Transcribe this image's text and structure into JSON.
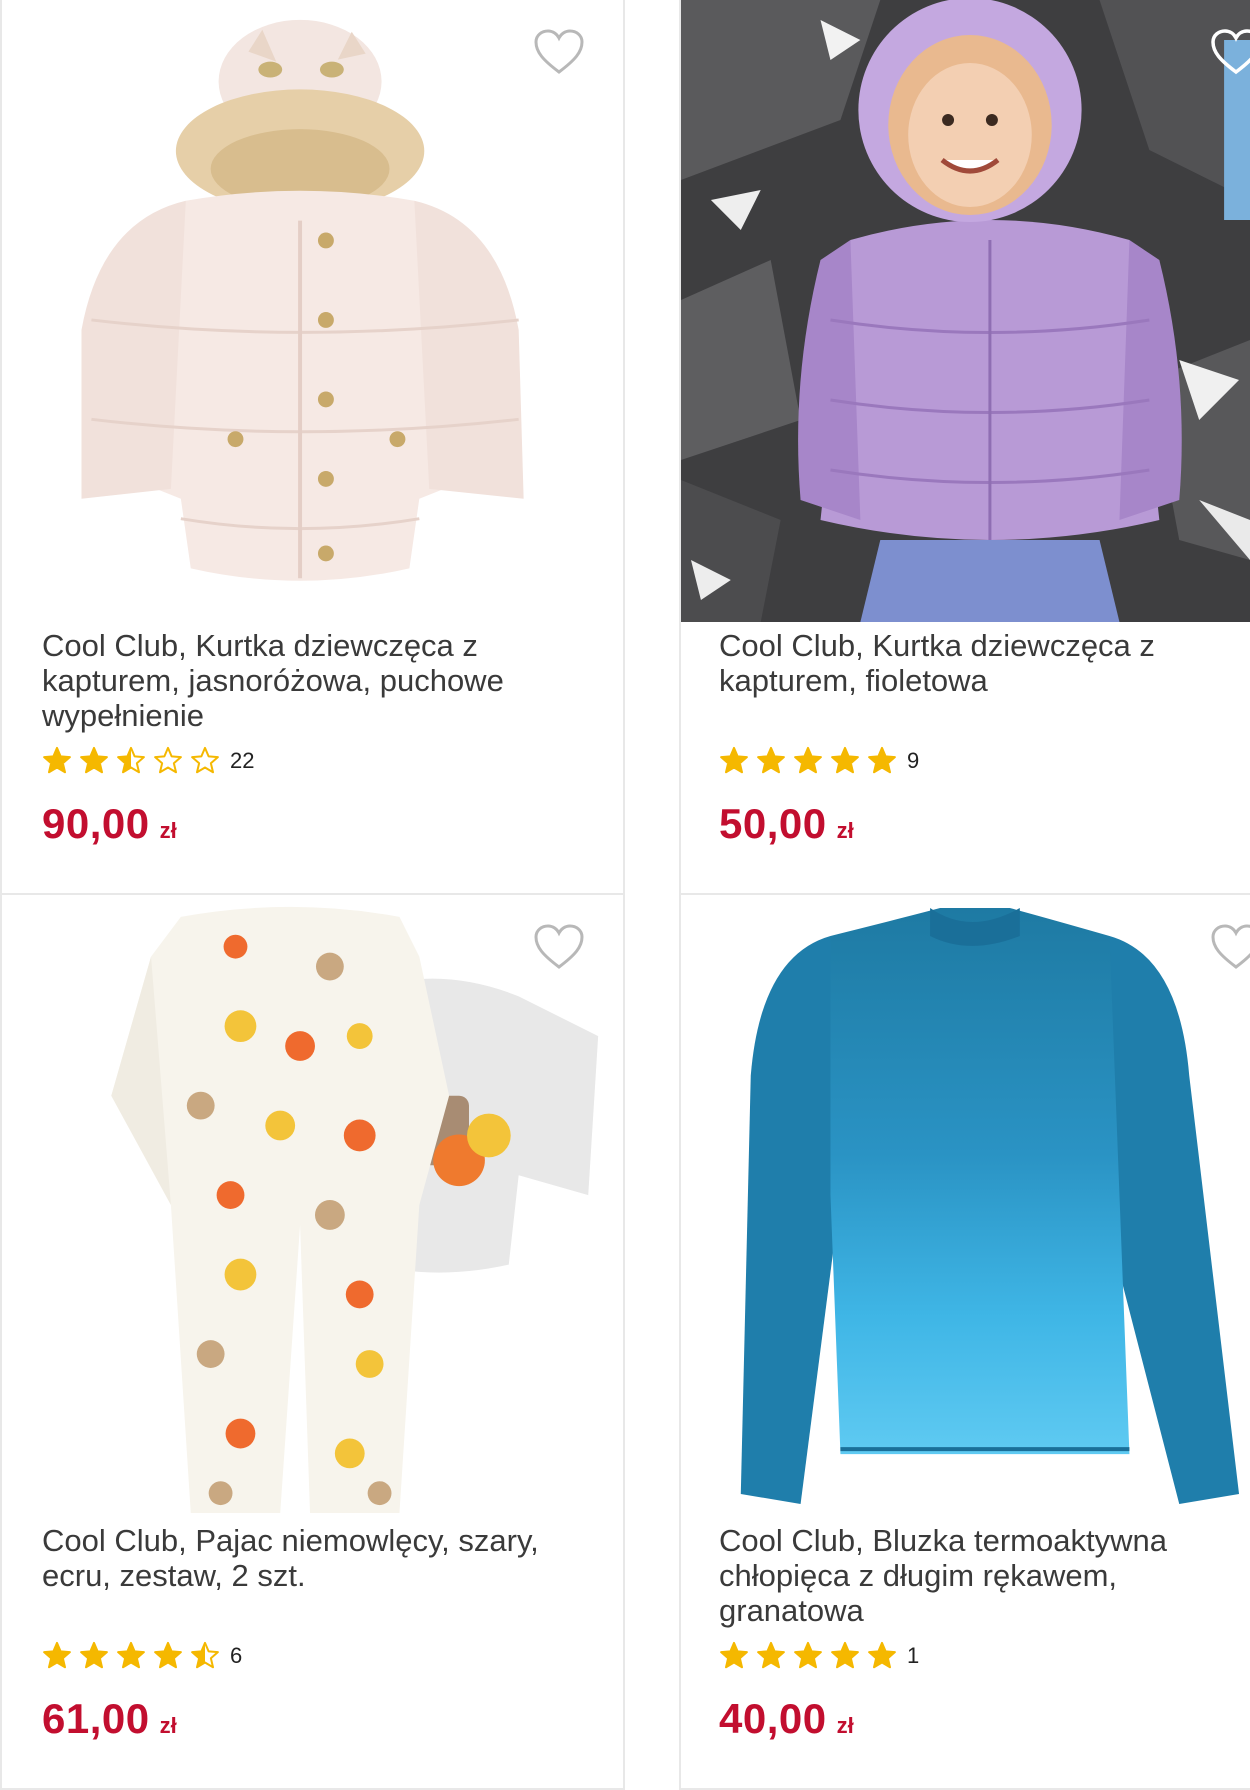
{
  "products": [
    {
      "title": "Cool Club, Kurtka dziewczęca z kapturem, jasnoróżowa, puchowe wypełnienie",
      "rating": 2.5,
      "review_count": "22",
      "price": "90,00",
      "currency": "zł",
      "image_icon": "pink-winter-jacket-image",
      "favorite_icon": "heart-outline-icon"
    },
    {
      "title": "Cool Club, Kurtka dziewczęca z kapturem, fioletowa",
      "rating": 5,
      "review_count": "9",
      "price": "50,00",
      "currency": "zł",
      "image_icon": "purple-puffer-jacket-photo",
      "favorite_icon": "heart-outline-icon"
    },
    {
      "title": "Cool Club, Pajac niemowlęcy, szary, ecru, zestaw, 2 szt.",
      "rating": 4.5,
      "review_count": "6",
      "price": "61,00",
      "currency": "zł",
      "image_icon": "baby-romper-set-image",
      "favorite_icon": "heart-outline-icon"
    },
    {
      "title": "Cool Club, Bluzka termoaktywna chłopięca z długim rękawem, granatowa",
      "rating": 5,
      "review_count": "1",
      "price": "40,00",
      "currency": "zł",
      "image_icon": "blue-thermal-shirt-image",
      "favorite_icon": "heart-outline-icon"
    }
  ],
  "colors": {
    "price": "#c20e2f",
    "star": "#f5b800",
    "border": "#e8e8e8"
  }
}
